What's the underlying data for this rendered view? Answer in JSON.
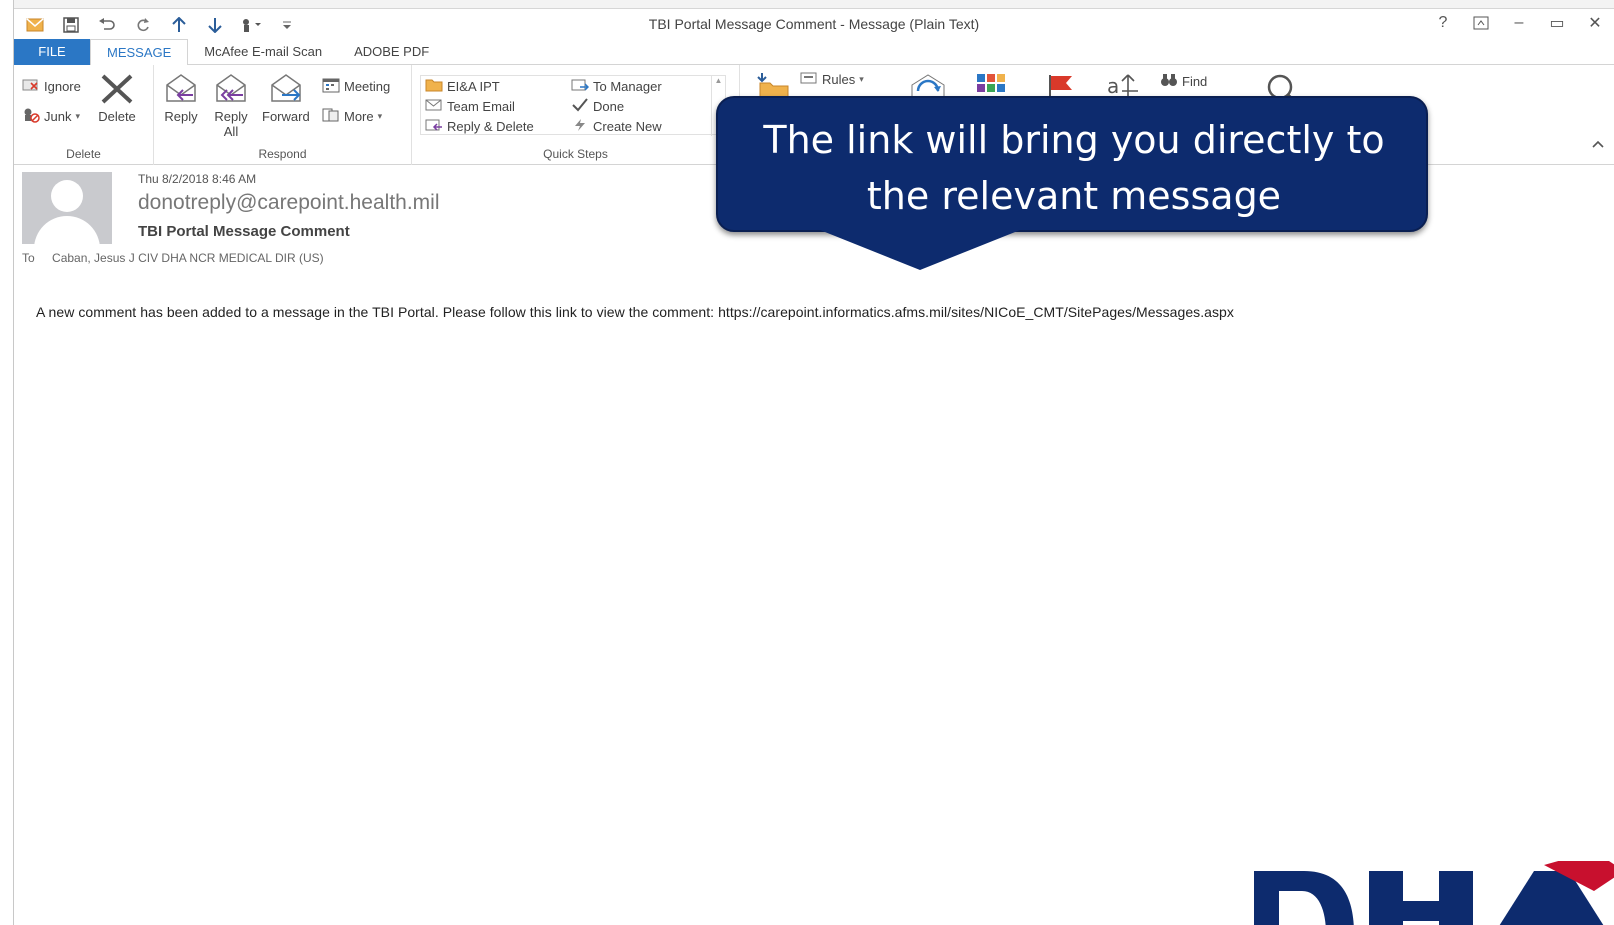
{
  "window": {
    "title": "TBI Portal Message Comment - Message (Plain Text)",
    "help": "?",
    "minimize": "–",
    "maximize": "▭",
    "close": "✕"
  },
  "tabs": [
    {
      "label": "FILE"
    },
    {
      "label": "MESSAGE"
    },
    {
      "label": "McAfee E-mail Scan"
    },
    {
      "label": "ADOBE PDF"
    }
  ],
  "ribbon": {
    "delete_group": {
      "label": "Delete",
      "ignore": "Ignore",
      "junk": "Junk",
      "delete": "Delete"
    },
    "respond_group": {
      "label": "Respond",
      "reply": "Reply",
      "reply_all_1": "Reply",
      "reply_all_2": "All",
      "forward": "Forward",
      "meeting": "Meeting",
      "more": "More"
    },
    "quick_steps": {
      "label": "Quick Steps",
      "items": [
        "EI&A IPT",
        "Team Email",
        "Reply & Delete",
        "To Manager",
        "Done",
        "Create New"
      ]
    },
    "move": {
      "rules": "Rules"
    },
    "find": "Find"
  },
  "message": {
    "date": "Thu 8/2/2018 8:46 AM",
    "from": "donotreply@carepoint.health.mil",
    "subject": "TBI Portal Message Comment",
    "to_label": "To",
    "to": "Caban, Jesus J CIV DHA NCR MEDICAL DIR (US)",
    "body": "A new comment has been added to a message in the TBI Portal.  Please follow this link to view the comment: https://carepoint.informatics.afms.mil/sites/NICoE_CMT/SitePages/Messages.aspx"
  },
  "callout": {
    "line1": "The link will bring you directly to",
    "line2": "the relevant message"
  },
  "colors": {
    "accent": "#2b77c5",
    "callout": "#0d2b6e",
    "logo": "#0d2b6e",
    "logo_red": "#c8102e"
  }
}
